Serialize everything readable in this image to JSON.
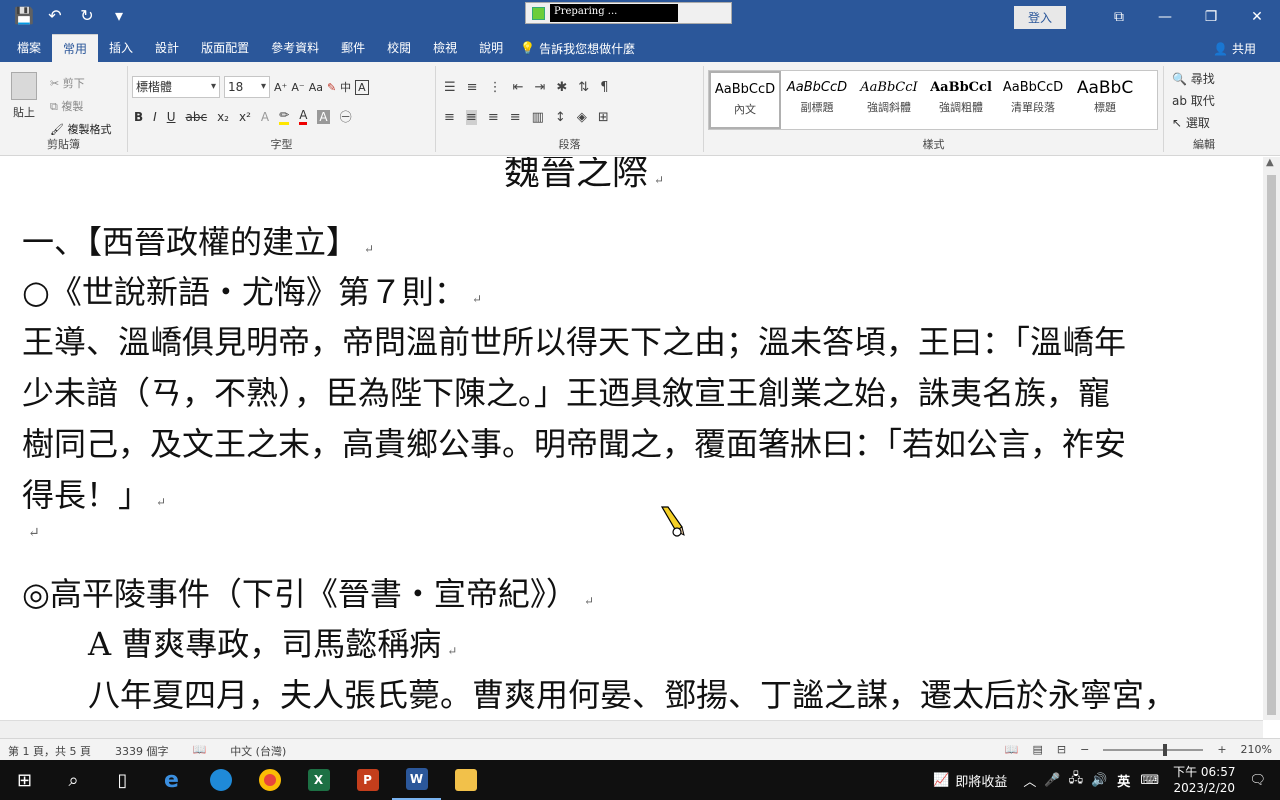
{
  "titlebar": {
    "progress_text": "Preparing ...",
    "login_label": "登入",
    "window_buttons": [
      "⧉",
      "—",
      "❐",
      "✕"
    ]
  },
  "tabs": [
    "檔案",
    "常用",
    "插入",
    "設計",
    "版面配置",
    "參考資料",
    "郵件",
    "校閱",
    "檢視",
    "說明"
  ],
  "active_tab": "常用",
  "tell_me": "告訴我您想做什麼",
  "share_label": "共用",
  "clipboard": {
    "paste_label": "貼上",
    "cut_label": "剪下",
    "copy_label": "複製",
    "format_painter_label": "複製格式",
    "group_label": "剪貼簿"
  },
  "font": {
    "name": "標楷體",
    "size": "18",
    "grow": "A⁺",
    "shrink": "A⁻",
    "case": "Aa",
    "bold": "B",
    "italic": "I",
    "underline": "U",
    "strike": "abc",
    "sub": "x₂",
    "sup": "x²",
    "group_label": "字型"
  },
  "paragraph": {
    "group_label": "段落"
  },
  "styles": {
    "items": [
      {
        "sample": "AaBbCcD",
        "name": "內文"
      },
      {
        "sample": "AaBbCcD",
        "name": "副標題"
      },
      {
        "sample": "AaBbCcI",
        "name": "強調斜體"
      },
      {
        "sample": "AaBbCcl",
        "name": "強調粗體"
      },
      {
        "sample": "AaBbCcD",
        "name": "清單段落"
      },
      {
        "sample": "AaBbC",
        "name": "標題"
      }
    ],
    "group_label": "樣式"
  },
  "editing": {
    "find": "尋找",
    "replace": "取代",
    "select": "選取",
    "group_label": "編輯"
  },
  "document": {
    "title_fragment": "魏晉之際",
    "heading1": "一、【西晉政權的建立】",
    "section1": "○《世說新語・尤悔》第７則：",
    "p1_line1": "王導、溫嶠俱見明帝，帝問溫前世所以得天下之由；溫未答頃，王曰：「溫嶠年",
    "p1_line2": "少未諳（ㄢ，不熟），臣為陛下陳之。」王迺具敘宣王創業之始，誅夷名族，寵",
    "p1_line3": "樹同己，及文王之末，高貴鄉公事。明帝聞之，覆面箸牀曰：「若如公言，祚安",
    "p1_line4": "得長！」",
    "section2": "◎高平陵事件（下引《晉書・宣帝紀》）",
    "sub_a": "A 曹爽專政，司馬懿稱病",
    "p2_line1": "八年夏四月，夫人張氏薨。曹爽用何晏、鄧揚、丁謐之謀，遷太后於永寧宮，"
  },
  "status": {
    "page": "第 1 頁，共 5 頁",
    "words": "3339 個字",
    "language": "中文 (台灣)",
    "zoom": "210%"
  },
  "taskbar": {
    "tray_text": "即將收益",
    "ime": "英",
    "time": "下午 06:57",
    "date": "2023/2/20"
  }
}
